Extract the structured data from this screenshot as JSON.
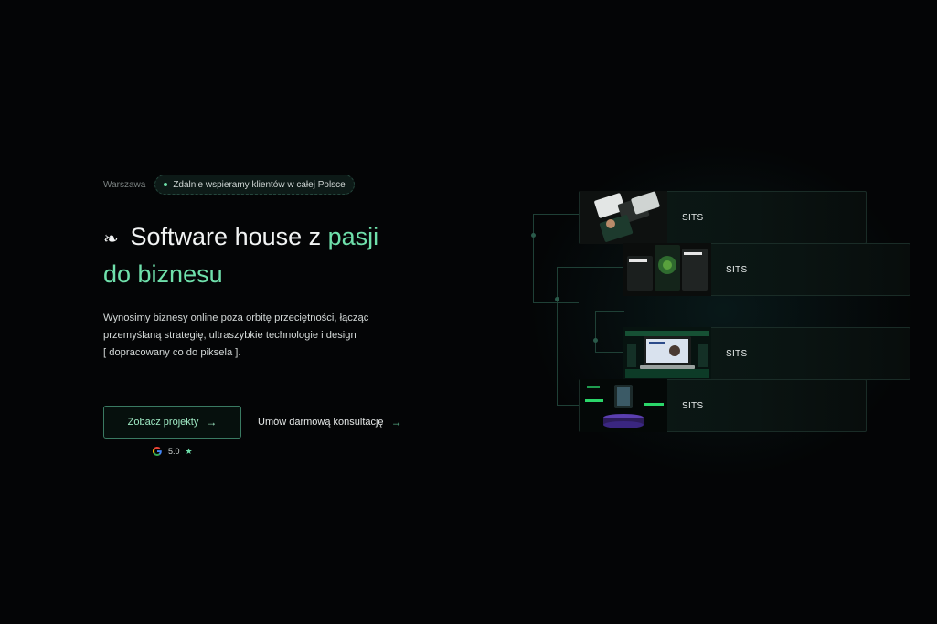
{
  "hero": {
    "city": "Warszawa",
    "remote_note": "Zdalnie wspieramy klientów w całej Polsce",
    "headline_icon": "❧",
    "headline_main": "Software house z ",
    "headline_accent_1": "pasji",
    "headline_accent_2": "do biznesu",
    "description_1": "Wynosimy biznesy online poza orbitę przeciętności, łącząc",
    "description_2": "przemyślaną strategię, ultraszybkie technologie i design",
    "description_3": "[ dopracowany co do piksela ].",
    "primary_button": "Zobacz projekty",
    "secondary_link": "Umów darmową konsultację",
    "arrow": "→",
    "rating_value": "5.0",
    "star": "★"
  },
  "showcase": {
    "cards": [
      {
        "label": "SITS"
      },
      {
        "label": "SITS"
      },
      {
        "label": "SITS"
      },
      {
        "label": "SITS"
      }
    ]
  },
  "colors": {
    "accent": "#6fe0ab",
    "background": "#040506",
    "border": "#3a7a62"
  }
}
